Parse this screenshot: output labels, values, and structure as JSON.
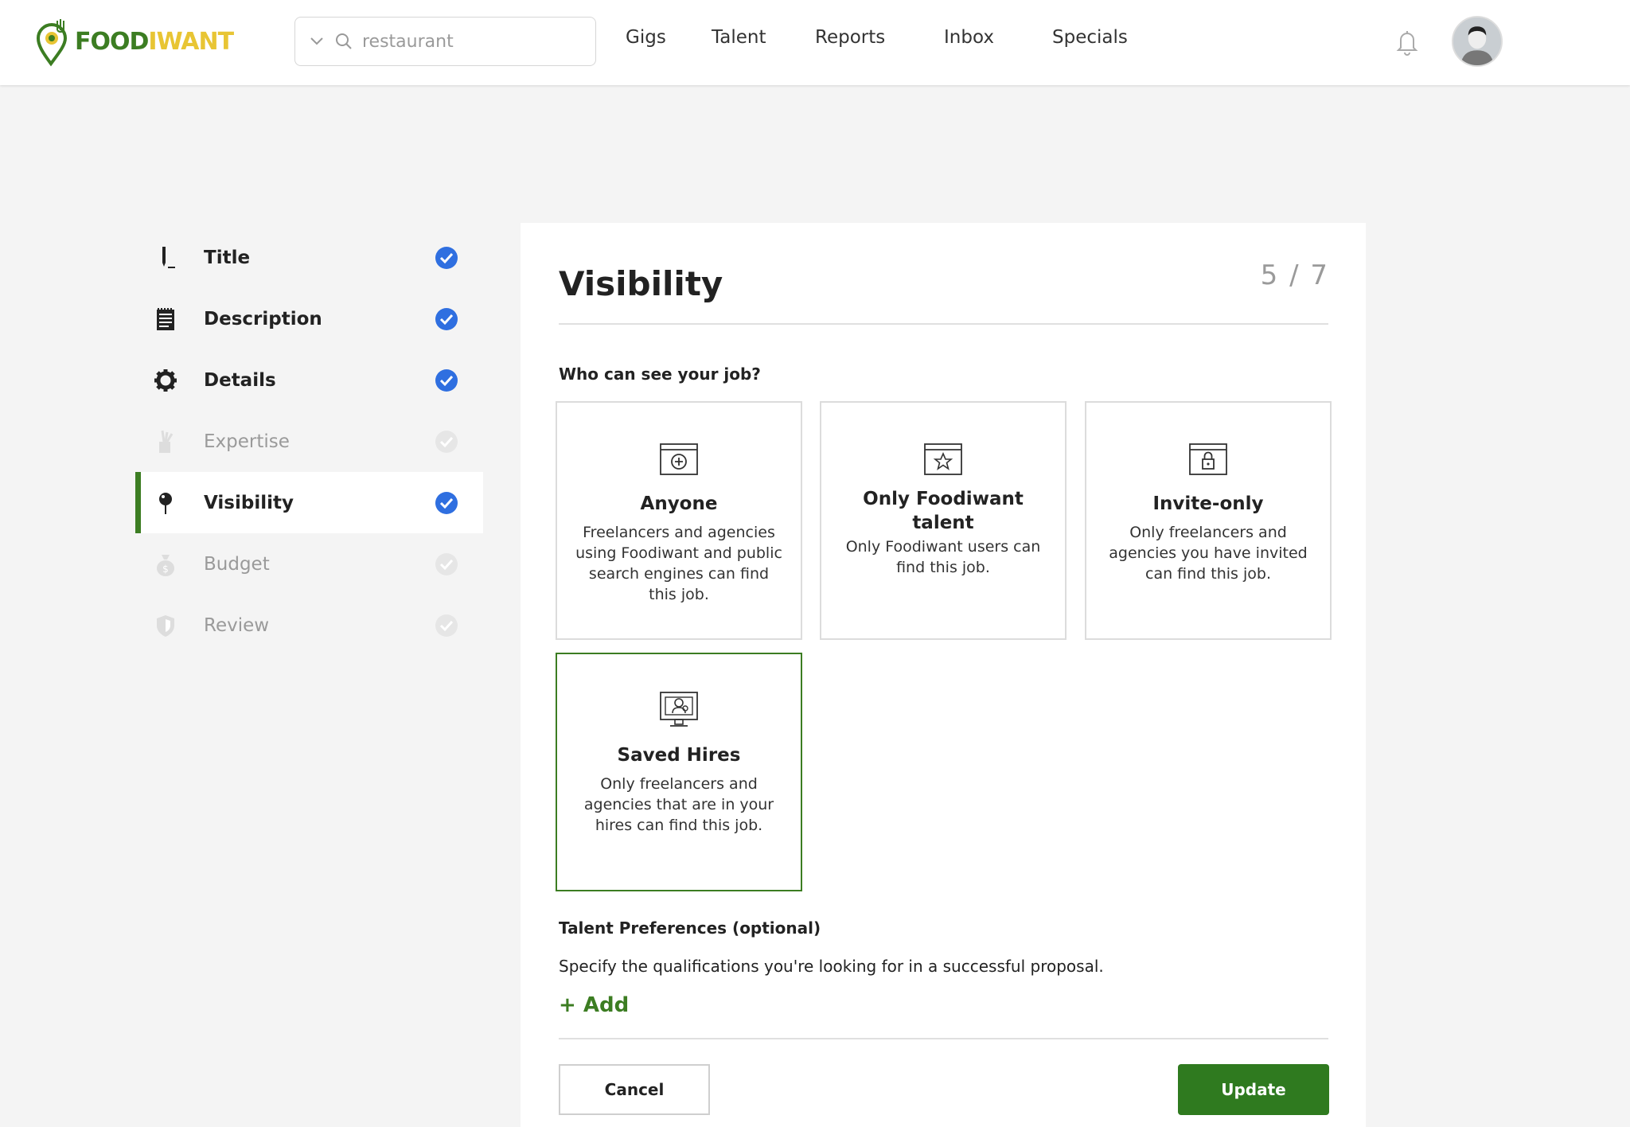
{
  "brand": {
    "part1": "FOOD",
    "part2": "IWANT",
    "green": "#3c7d22",
    "yellow": "#e8c534"
  },
  "search": {
    "value": "",
    "placeholder": "restaurant",
    "icon": "search-icon"
  },
  "nav": {
    "gigs": "Gigs",
    "talent": "Talent",
    "reports": "Reports",
    "inbox": "Inbox",
    "specials": "Specials"
  },
  "header_icons": {
    "notifications": "bell-icon",
    "profile": "avatar"
  },
  "steps": [
    {
      "label": "Title",
      "icon": "pen-icon",
      "status": "complete"
    },
    {
      "label": "Description",
      "icon": "notepad-icon",
      "status": "complete"
    },
    {
      "label": "Details",
      "icon": "gear-icon",
      "status": "complete"
    },
    {
      "label": "Expertise",
      "icon": "brush-icon",
      "status": "pending"
    },
    {
      "label": "Visibility",
      "icon": "pin-icon",
      "status": "active"
    },
    {
      "label": "Budget",
      "icon": "money-bag-icon",
      "status": "pending"
    },
    {
      "label": "Review",
      "icon": "shield-icon",
      "status": "pending"
    }
  ],
  "card": {
    "title": "Visibility",
    "step": "5 / 7",
    "question": "Who can see your job?",
    "options": [
      {
        "title": "Anyone",
        "desc": "Freelancers and agencies using Foodiwant and public search engines can find this job.",
        "icon": "browser-plus-icon",
        "selected": false
      },
      {
        "title": "Only Foodiwant talent",
        "desc": "Only Foodiwant users can find this job.",
        "icon": "browser-star-icon",
        "selected": false
      },
      {
        "title": "Invite-only",
        "desc": "Only freelancers and agencies you have invited can find this job.",
        "icon": "browser-lock-icon",
        "selected": false
      },
      {
        "title": "Saved Hires",
        "desc": "Only freelancers and agencies that are in your hires can find this job.",
        "icon": "monitor-person-icon",
        "selected": true
      }
    ],
    "preferences_title": "Talent Preferences (optional)",
    "preferences_desc": "Specify the qualifications you're looking for in a successful proposal.",
    "add_label": "+ Add",
    "cancel_label": "Cancel",
    "update_label": "Update",
    "accent": "#2f7a1f",
    "check_color": "#2f6fe0"
  }
}
